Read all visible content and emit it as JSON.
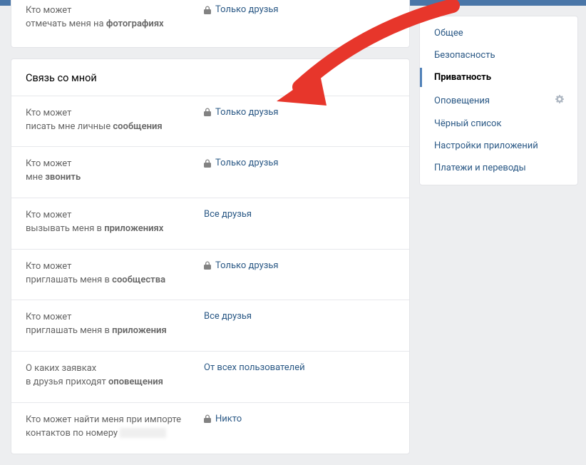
{
  "colors": {
    "accent": "#4a76a8",
    "link": "#2a5885"
  },
  "top_panel": {
    "row": {
      "line1": "Кто может",
      "line2_pre": "отмечать меня на ",
      "line2_bold": "фотографиях",
      "locked": true,
      "value": "Только друзья"
    }
  },
  "section_title": "Связь со мной",
  "rows": [
    {
      "line1": "Кто может",
      "line2_pre": "писать мне личные ",
      "line2_bold": "сообщения",
      "locked": true,
      "value": "Только друзья"
    },
    {
      "line1": "Кто может",
      "line2_pre": "мне ",
      "line2_bold": "звонить",
      "locked": true,
      "value": "Только друзья"
    },
    {
      "line1": "Кто может",
      "line2_pre": "вызывать меня в ",
      "line2_bold": "приложениях",
      "locked": false,
      "value": "Все друзья"
    },
    {
      "line1": "Кто может",
      "line2_pre": "приглашать меня в ",
      "line2_bold": "сообщества",
      "locked": true,
      "value": "Только друзья"
    },
    {
      "line1": "Кто может",
      "line2_pre": "приглашать меня в ",
      "line2_bold": "приложения",
      "locked": false,
      "value": "Все друзья"
    },
    {
      "line1": "О каких заявках",
      "line2_pre": "в друзья приходят ",
      "line2_bold": "оповещения",
      "locked": false,
      "value": "От всех пользователей"
    },
    {
      "line1": "Кто может найти меня при импорте",
      "line2_pre": "контактов по номеру",
      "line2_bold": "",
      "phone_blur": true,
      "locked": true,
      "value": "Никто"
    }
  ],
  "sidebar": {
    "items": [
      {
        "label": "Общее",
        "active": false
      },
      {
        "label": "Безопасность",
        "active": false
      },
      {
        "label": "Приватность",
        "active": true
      },
      {
        "label": "Оповещения",
        "active": false,
        "gear": true
      },
      {
        "label": "Чёрный список",
        "active": false
      },
      {
        "label": "Настройки приложений",
        "active": false
      },
      {
        "label": "Платежи и переводы",
        "active": false
      }
    ]
  }
}
